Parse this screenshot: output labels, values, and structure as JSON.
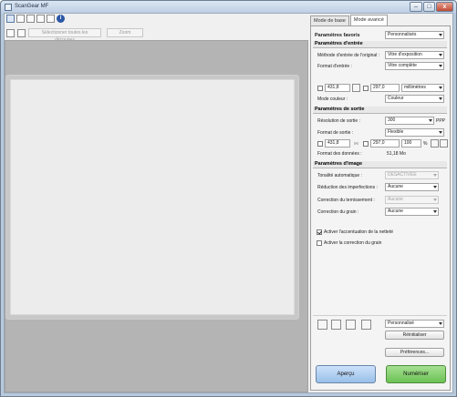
{
  "window": {
    "title": "ScanGear MF",
    "minimize": "–",
    "maximize": "□",
    "close": "x"
  },
  "toolbar": {
    "select_all": "Sélectionner toutes les découpes",
    "zoom": "Zoom"
  },
  "tabs": [
    "Mode de base",
    "Mode avancé"
  ],
  "favorites": {
    "label": "Paramètres favoris",
    "value": "Personnalisés"
  },
  "input": {
    "heading": "Paramètres d'entrée",
    "method_label": "Méthode d'entrée de l'original :",
    "method_value": "Vitre d'exposition",
    "format_label": "Format d'entrée :",
    "format_value": "Vitre complète",
    "width": "431,8",
    "height": "297,0",
    "unit": "millimètres",
    "color_label": "Mode couleur :",
    "color_value": "Couleur"
  },
  "output": {
    "heading": "Paramètres de sortie",
    "resolution_label": "Résolution de sortie :",
    "resolution_value": "300",
    "resolution_unit": "PPP",
    "format_label": "Format de sortie :",
    "format_value": "Flexible",
    "width": "431,8",
    "height": "297,0",
    "scale": "100",
    "scale_unit": "%",
    "data_label": "Format des données :",
    "data_value": "51,18 Mo"
  },
  "image": {
    "heading": "Paramètres d'image",
    "tone_label": "Tonalité automatique :",
    "tone_value": "DÉSACTIVÉE",
    "imperfection_label": "Réduction des imperfections :",
    "imperfection_value": "Aucune",
    "fade_label": "Correction du ternissement :",
    "fade_value": "Aucune",
    "grain_label": "Correction du grain :",
    "grain_value": "Aucune",
    "sharpen_label": "Activer l'accentuation de la netteté",
    "sharpen_checked": true,
    "grainfix_label": "Activer la correction du grain",
    "grainfix_checked": false
  },
  "bottom": {
    "custom_value": "Personnalisé",
    "reset": "Réinitialiser",
    "preferences": "Préférences...",
    "preview": "Aperçu",
    "scan": "Numériser"
  }
}
